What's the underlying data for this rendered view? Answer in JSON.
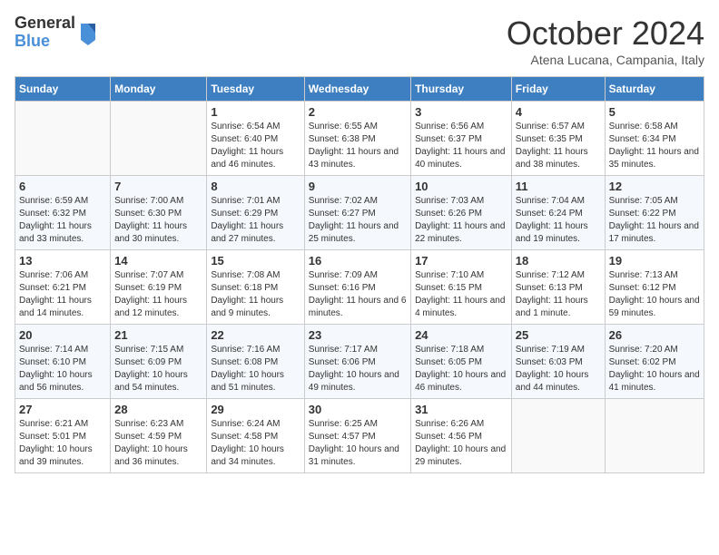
{
  "header": {
    "logo_line1": "General",
    "logo_line2": "Blue",
    "month": "October 2024",
    "location": "Atena Lucana, Campania, Italy"
  },
  "days_of_week": [
    "Sunday",
    "Monday",
    "Tuesday",
    "Wednesday",
    "Thursday",
    "Friday",
    "Saturday"
  ],
  "weeks": [
    [
      {
        "day": "",
        "sunrise": "",
        "sunset": "",
        "daylight": ""
      },
      {
        "day": "",
        "sunrise": "",
        "sunset": "",
        "daylight": ""
      },
      {
        "day": "1",
        "sunrise": "Sunrise: 6:54 AM",
        "sunset": "Sunset: 6:40 PM",
        "daylight": "Daylight: 11 hours and 46 minutes."
      },
      {
        "day": "2",
        "sunrise": "Sunrise: 6:55 AM",
        "sunset": "Sunset: 6:38 PM",
        "daylight": "Daylight: 11 hours and 43 minutes."
      },
      {
        "day": "3",
        "sunrise": "Sunrise: 6:56 AM",
        "sunset": "Sunset: 6:37 PM",
        "daylight": "Daylight: 11 hours and 40 minutes."
      },
      {
        "day": "4",
        "sunrise": "Sunrise: 6:57 AM",
        "sunset": "Sunset: 6:35 PM",
        "daylight": "Daylight: 11 hours and 38 minutes."
      },
      {
        "day": "5",
        "sunrise": "Sunrise: 6:58 AM",
        "sunset": "Sunset: 6:34 PM",
        "daylight": "Daylight: 11 hours and 35 minutes."
      }
    ],
    [
      {
        "day": "6",
        "sunrise": "Sunrise: 6:59 AM",
        "sunset": "Sunset: 6:32 PM",
        "daylight": "Daylight: 11 hours and 33 minutes."
      },
      {
        "day": "7",
        "sunrise": "Sunrise: 7:00 AM",
        "sunset": "Sunset: 6:30 PM",
        "daylight": "Daylight: 11 hours and 30 minutes."
      },
      {
        "day": "8",
        "sunrise": "Sunrise: 7:01 AM",
        "sunset": "Sunset: 6:29 PM",
        "daylight": "Daylight: 11 hours and 27 minutes."
      },
      {
        "day": "9",
        "sunrise": "Sunrise: 7:02 AM",
        "sunset": "Sunset: 6:27 PM",
        "daylight": "Daylight: 11 hours and 25 minutes."
      },
      {
        "day": "10",
        "sunrise": "Sunrise: 7:03 AM",
        "sunset": "Sunset: 6:26 PM",
        "daylight": "Daylight: 11 hours and 22 minutes."
      },
      {
        "day": "11",
        "sunrise": "Sunrise: 7:04 AM",
        "sunset": "Sunset: 6:24 PM",
        "daylight": "Daylight: 11 hours and 19 minutes."
      },
      {
        "day": "12",
        "sunrise": "Sunrise: 7:05 AM",
        "sunset": "Sunset: 6:22 PM",
        "daylight": "Daylight: 11 hours and 17 minutes."
      }
    ],
    [
      {
        "day": "13",
        "sunrise": "Sunrise: 7:06 AM",
        "sunset": "Sunset: 6:21 PM",
        "daylight": "Daylight: 11 hours and 14 minutes."
      },
      {
        "day": "14",
        "sunrise": "Sunrise: 7:07 AM",
        "sunset": "Sunset: 6:19 PM",
        "daylight": "Daylight: 11 hours and 12 minutes."
      },
      {
        "day": "15",
        "sunrise": "Sunrise: 7:08 AM",
        "sunset": "Sunset: 6:18 PM",
        "daylight": "Daylight: 11 hours and 9 minutes."
      },
      {
        "day": "16",
        "sunrise": "Sunrise: 7:09 AM",
        "sunset": "Sunset: 6:16 PM",
        "daylight": "Daylight: 11 hours and 6 minutes."
      },
      {
        "day": "17",
        "sunrise": "Sunrise: 7:10 AM",
        "sunset": "Sunset: 6:15 PM",
        "daylight": "Daylight: 11 hours and 4 minutes."
      },
      {
        "day": "18",
        "sunrise": "Sunrise: 7:12 AM",
        "sunset": "Sunset: 6:13 PM",
        "daylight": "Daylight: 11 hours and 1 minute."
      },
      {
        "day": "19",
        "sunrise": "Sunrise: 7:13 AM",
        "sunset": "Sunset: 6:12 PM",
        "daylight": "Daylight: 10 hours and 59 minutes."
      }
    ],
    [
      {
        "day": "20",
        "sunrise": "Sunrise: 7:14 AM",
        "sunset": "Sunset: 6:10 PM",
        "daylight": "Daylight: 10 hours and 56 minutes."
      },
      {
        "day": "21",
        "sunrise": "Sunrise: 7:15 AM",
        "sunset": "Sunset: 6:09 PM",
        "daylight": "Daylight: 10 hours and 54 minutes."
      },
      {
        "day": "22",
        "sunrise": "Sunrise: 7:16 AM",
        "sunset": "Sunset: 6:08 PM",
        "daylight": "Daylight: 10 hours and 51 minutes."
      },
      {
        "day": "23",
        "sunrise": "Sunrise: 7:17 AM",
        "sunset": "Sunset: 6:06 PM",
        "daylight": "Daylight: 10 hours and 49 minutes."
      },
      {
        "day": "24",
        "sunrise": "Sunrise: 7:18 AM",
        "sunset": "Sunset: 6:05 PM",
        "daylight": "Daylight: 10 hours and 46 minutes."
      },
      {
        "day": "25",
        "sunrise": "Sunrise: 7:19 AM",
        "sunset": "Sunset: 6:03 PM",
        "daylight": "Daylight: 10 hours and 44 minutes."
      },
      {
        "day": "26",
        "sunrise": "Sunrise: 7:20 AM",
        "sunset": "Sunset: 6:02 PM",
        "daylight": "Daylight: 10 hours and 41 minutes."
      }
    ],
    [
      {
        "day": "27",
        "sunrise": "Sunrise: 6:21 AM",
        "sunset": "Sunset: 5:01 PM",
        "daylight": "Daylight: 10 hours and 39 minutes."
      },
      {
        "day": "28",
        "sunrise": "Sunrise: 6:23 AM",
        "sunset": "Sunset: 4:59 PM",
        "daylight": "Daylight: 10 hours and 36 minutes."
      },
      {
        "day": "29",
        "sunrise": "Sunrise: 6:24 AM",
        "sunset": "Sunset: 4:58 PM",
        "daylight": "Daylight: 10 hours and 34 minutes."
      },
      {
        "day": "30",
        "sunrise": "Sunrise: 6:25 AM",
        "sunset": "Sunset: 4:57 PM",
        "daylight": "Daylight: 10 hours and 31 minutes."
      },
      {
        "day": "31",
        "sunrise": "Sunrise: 6:26 AM",
        "sunset": "Sunset: 4:56 PM",
        "daylight": "Daylight: 10 hours and 29 minutes."
      },
      {
        "day": "",
        "sunrise": "",
        "sunset": "",
        "daylight": ""
      },
      {
        "day": "",
        "sunrise": "",
        "sunset": "",
        "daylight": ""
      }
    ]
  ]
}
